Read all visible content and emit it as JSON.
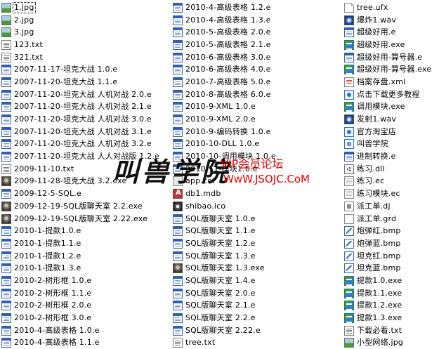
{
  "columns": [
    [
      {
        "name": "1.jpg",
        "icon": "image-icon",
        "selected": true
      },
      {
        "name": "2.jpg",
        "icon": "image-icon"
      },
      {
        "name": "3.jpg",
        "icon": "image-icon"
      },
      {
        "name": "123.txt",
        "icon": "text-file-icon"
      },
      {
        "name": "321.txt",
        "icon": "text-file-icon"
      },
      {
        "name": "2007-11-17-坦克大战 1.0.e",
        "icon": "program-icon"
      },
      {
        "name": "2007-11-20-坦克大战 1.1.e",
        "icon": "program-icon"
      },
      {
        "name": "2007-11-20-坦克大战 人机对战 2.0.e",
        "icon": "program-icon"
      },
      {
        "name": "2007-11-20-坦克大战 人机对战 2.1.e",
        "icon": "program-icon"
      },
      {
        "name": "2007-11-20-坦克大战 人机对战 3.0.e",
        "icon": "program-icon"
      },
      {
        "name": "2007-11-20-坦克大战 人机对战 3.1.e",
        "icon": "program-icon"
      },
      {
        "name": "2007-11-20-坦克大战 人机对战 3.2.e",
        "icon": "program-icon"
      },
      {
        "name": "2007-11-20-坦克大战 人人对战版 1.2.e",
        "icon": "program-icon"
      },
      {
        "name": "2009-11-10.txt",
        "icon": "text-file-icon"
      },
      {
        "name": "2009-11-28-坦克大战 3.2.exe",
        "icon": "photo-icon"
      },
      {
        "name": "2009-12-5-SQL.e",
        "icon": "program-icon"
      },
      {
        "name": "2009-12-19-SQL版聊天室 2.2.exe",
        "icon": "photo-icon"
      },
      {
        "name": "2009-12-19-SQL版聊天室 2.22.exe",
        "icon": "photo-icon"
      },
      {
        "name": "2010-1-提款1.0.e",
        "icon": "program-icon"
      },
      {
        "name": "2010-1-提款1.1.e",
        "icon": "program-icon"
      },
      {
        "name": "2010-1-提款1.2.e",
        "icon": "program-icon"
      },
      {
        "name": "2010-1-提款1.3.e",
        "icon": "program-icon"
      },
      {
        "name": "2010-2-树形框 1.0.e",
        "icon": "program-icon"
      },
      {
        "name": "2010-2-树形框 1.1.e",
        "icon": "program-icon"
      },
      {
        "name": "2010-2-树形框 2.0.e",
        "icon": "program-icon"
      },
      {
        "name": "2010-2-树形框 3.0.e",
        "icon": "program-icon"
      },
      {
        "name": "2010-4-高级表格 1.0.e",
        "icon": "program-icon"
      },
      {
        "name": "2010-4-高级表格 1.1.e",
        "icon": "program-icon"
      }
    ],
    [
      {
        "name": "2010-4-高级表格 1.2.e",
        "icon": "program-icon"
      },
      {
        "name": "2010-4-高级表格 1.3.e",
        "icon": "program-icon"
      },
      {
        "name": "2010-5-高级表格 2.0.e",
        "icon": "program-icon"
      },
      {
        "name": "2010-5-高级表格 2.1.e",
        "icon": "program-icon"
      },
      {
        "name": "2010-6-高级表格 3.0.e",
        "icon": "program-icon"
      },
      {
        "name": "2010-6-高级表格 4.0.e",
        "icon": "program-icon"
      },
      {
        "name": "2010-7-高级表格 5.0.e",
        "icon": "program-icon"
      },
      {
        "name": "2010-8-高级表格 6.0.e",
        "icon": "program-icon"
      },
      {
        "name": "2010-9-XML 1.0.e",
        "icon": "program-icon"
      },
      {
        "name": "2010-9-XML 2.0.e",
        "icon": "program-icon"
      },
      {
        "name": "2010-9-编码转换 1.0.e",
        "icon": "program-icon"
      },
      {
        "name": "2010-10-DLL 1.0.e",
        "icon": "program-icon"
      },
      {
        "name": "2010-10-调用模块 1.0.e",
        "icon": "program-icon"
      },
      {
        "name": "2010-11-模块1.0.e",
        "icon": "program-icon"
      },
      {
        "name": "app.cof",
        "icon": "app-icon"
      },
      {
        "name": "db1.mdb",
        "icon": "database-icon"
      },
      {
        "name": "shibao.ico",
        "icon": "ico-file-icon"
      },
      {
        "name": "SQL版聊天室 1.0.e",
        "icon": "program-icon"
      },
      {
        "name": "SQL版聊天室 1.1.e",
        "icon": "program-icon"
      },
      {
        "name": "SQL版聊天室 1.2.e",
        "icon": "program-icon"
      },
      {
        "name": "SQL版聊天室 1.3.e",
        "icon": "program-icon"
      },
      {
        "name": "SQL版聊天室 1.3.exe",
        "icon": "photo-icon"
      },
      {
        "name": "SQL版聊天室 1.4.e",
        "icon": "program-icon"
      },
      {
        "name": "SQL版聊天室 2.0.e",
        "icon": "program-icon"
      },
      {
        "name": "SQL版聊天室 2.1.e",
        "icon": "program-icon"
      },
      {
        "name": "SQL版聊天室 2.2.e",
        "icon": "program-icon"
      },
      {
        "name": "SQL版聊天室 2.22.e",
        "icon": "program-icon"
      },
      {
        "name": "tree.txt",
        "icon": "text-file-icon"
      }
    ],
    [
      {
        "name": "tree.ufx",
        "icon": "document-icon"
      },
      {
        "name": "爆炸1.wav",
        "icon": "audio-icon"
      },
      {
        "name": "超级好用.e",
        "icon": "program-icon"
      },
      {
        "name": "超级好用.exe",
        "icon": "source-exe-icon"
      },
      {
        "name": "超级好用-算号器.e",
        "icon": "program-icon"
      },
      {
        "name": "超级好用-算号器.exe",
        "icon": "source-exe-icon"
      },
      {
        "name": "档案存盘.xml",
        "icon": "xml-icon"
      },
      {
        "name": "点击下载更多教程",
        "icon": "link-icon"
      },
      {
        "name": "调用模块.exe",
        "icon": "source-exe-icon"
      },
      {
        "name": "发射1.wav",
        "icon": "audio-icon"
      },
      {
        "name": "官方淘宝店",
        "icon": "link-icon"
      },
      {
        "name": "叫兽学院",
        "icon": "shop-link-icon"
      },
      {
        "name": "进制转换.e",
        "icon": "program-icon"
      },
      {
        "name": "练习.dll",
        "icon": "dll-icon"
      },
      {
        "name": "练习.ec",
        "icon": "ec-file-icon"
      },
      {
        "name": "练习模块.ec",
        "icon": "ec-file-icon"
      },
      {
        "name": "派工单.dj",
        "icon": "dj-file-icon"
      },
      {
        "name": "派工单.grd",
        "icon": "grd-file-icon"
      },
      {
        "name": "炮弹红.bmp",
        "icon": "bitmap-icon"
      },
      {
        "name": "炮弹蓝.bmp",
        "icon": "bitmap-icon"
      },
      {
        "name": "坦克红.bmp",
        "icon": "bitmap-icon"
      },
      {
        "name": "坦克蓝.bmp",
        "icon": "bitmap-icon"
      },
      {
        "name": "提款1.0.exe",
        "icon": "source-exe-icon"
      },
      {
        "name": "提款1.1.exe",
        "icon": "source-exe-icon"
      },
      {
        "name": "提款1.2.exe",
        "icon": "source-exe-icon"
      },
      {
        "name": "提款1.3.exe",
        "icon": "source-exe-icon"
      },
      {
        "name": "下载必看.txt",
        "icon": "text-file-icon"
      },
      {
        "name": "小型网络.jpg",
        "icon": "image-icon"
      }
    ]
  ],
  "watermark": {
    "logo": "叫兽学院",
    "vip": "VIP会员论坛",
    "site": "WwW.JSOJC.CoM",
    "color": "#e60000"
  }
}
